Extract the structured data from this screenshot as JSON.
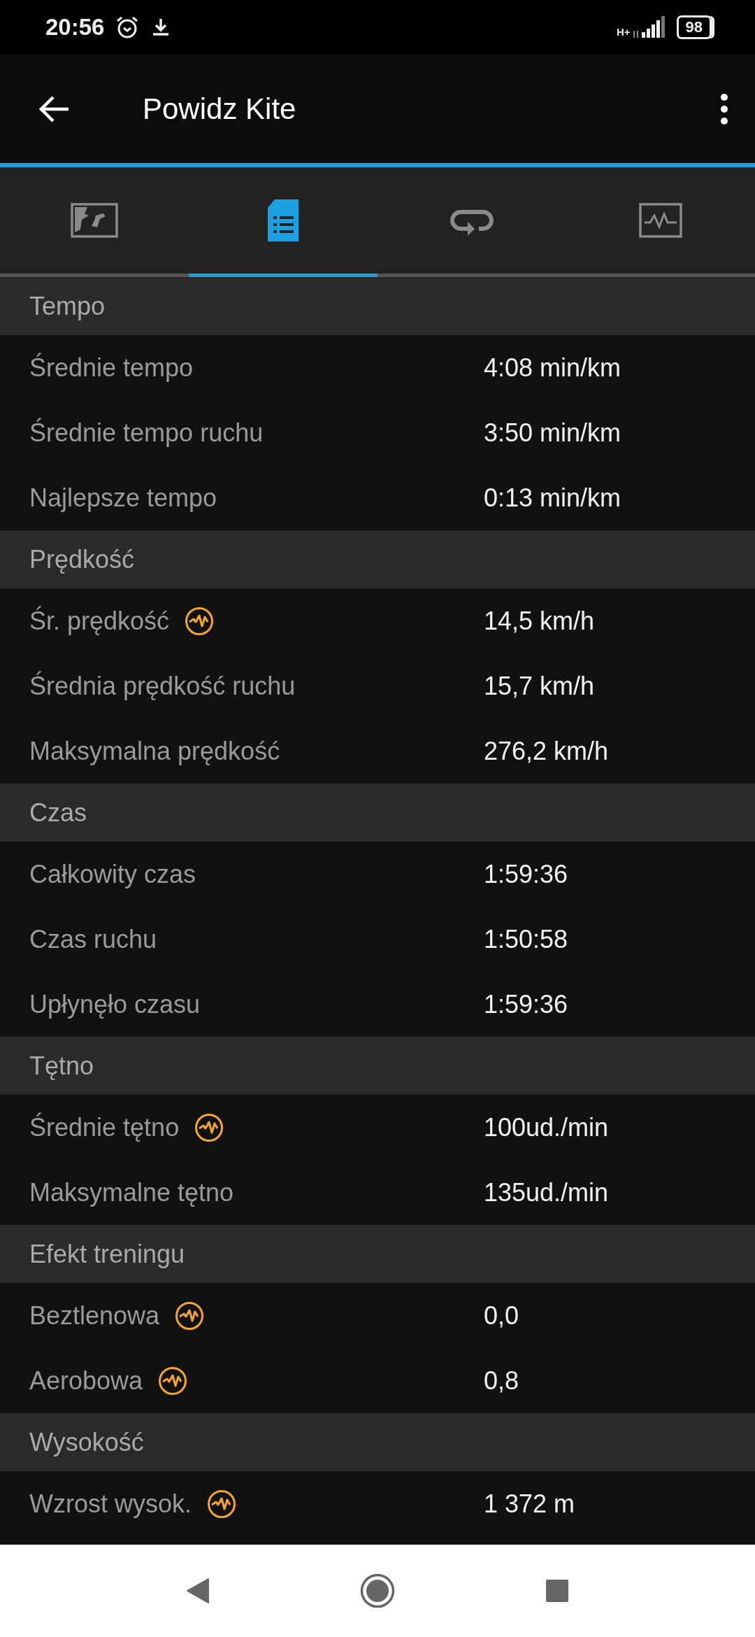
{
  "status_bar": {
    "time": "20:56",
    "network": "H+",
    "battery": "98"
  },
  "app_bar": {
    "title": "Powidz Kite"
  },
  "tabs": [
    {
      "kind": "map",
      "selected": false
    },
    {
      "kind": "stats",
      "selected": true
    },
    {
      "kind": "laps",
      "selected": false
    },
    {
      "kind": "chart",
      "selected": false
    }
  ],
  "sections": [
    {
      "title": "Tempo",
      "rows": [
        {
          "label": "Średnie tempo",
          "value": "4:08 min/km",
          "info": false
        },
        {
          "label": "Średnie tempo ruchu",
          "value": "3:50 min/km",
          "info": false
        },
        {
          "label": "Najlepsze tempo",
          "value": "0:13 min/km",
          "info": false
        }
      ]
    },
    {
      "title": "Prędkość",
      "rows": [
        {
          "label": "Śr. prędkość",
          "value": "14,5 km/h",
          "info": true
        },
        {
          "label": "Średnia prędkość ruchu",
          "value": "15,7 km/h",
          "info": false
        },
        {
          "label": "Maksymalna prędkość",
          "value": "276,2 km/h",
          "info": false
        }
      ]
    },
    {
      "title": "Czas",
      "rows": [
        {
          "label": "Całkowity czas",
          "value": "1:59:36",
          "info": false
        },
        {
          "label": "Czas ruchu",
          "value": "1:50:58",
          "info": false
        },
        {
          "label": "Upłynęło czasu",
          "value": "1:59:36",
          "info": false
        }
      ]
    },
    {
      "title": "Tętno",
      "rows": [
        {
          "label": "Średnie tętno",
          "value": "100ud./min",
          "info": true
        },
        {
          "label": "Maksymalne tętno",
          "value": "135ud./min",
          "info": false
        }
      ]
    },
    {
      "title": "Efekt treningu",
      "rows": [
        {
          "label": "Beztlenowa",
          "value": "0,0",
          "info": true
        },
        {
          "label": "Aerobowa",
          "value": "0,8",
          "info": true
        }
      ]
    },
    {
      "title": "Wysokość",
      "rows": [
        {
          "label": "Wzrost wysok.",
          "value": "1 372 m",
          "info": true
        }
      ]
    }
  ]
}
